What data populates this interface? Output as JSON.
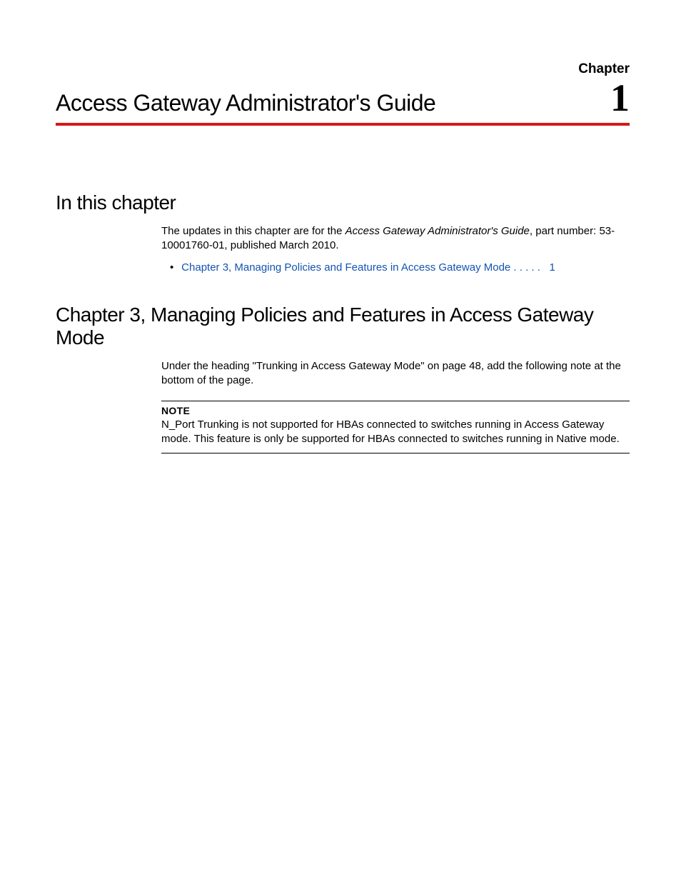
{
  "header": {
    "chapter_label": "Chapter",
    "doc_title": "Access Gateway Administrator's Guide",
    "chapter_number": "1"
  },
  "section1": {
    "heading": "In this chapter",
    "intro_pre": "The updates in this chapter are for the ",
    "intro_italic": "Access Gateway Administrator's Guide",
    "intro_post": ", part number: 53-10001760-01, published March 2010.",
    "toc_link_text": "Chapter 3, Managing Policies and Features in Access Gateway Mode . . . . .",
    "toc_link_page": "1"
  },
  "section2": {
    "heading": "Chapter 3, Managing Policies and Features in Access Gateway Mode",
    "body": "Under the heading \"Trunking in Access Gateway Mode\" on page 48, add the following note at the bottom of the page.",
    "note_label": "NOTE",
    "note_text": "N_Port Trunking is not supported for HBAs connected to switches running in Access Gateway mode. This feature is only be supported for HBAs connected to switches running in Native mode."
  }
}
